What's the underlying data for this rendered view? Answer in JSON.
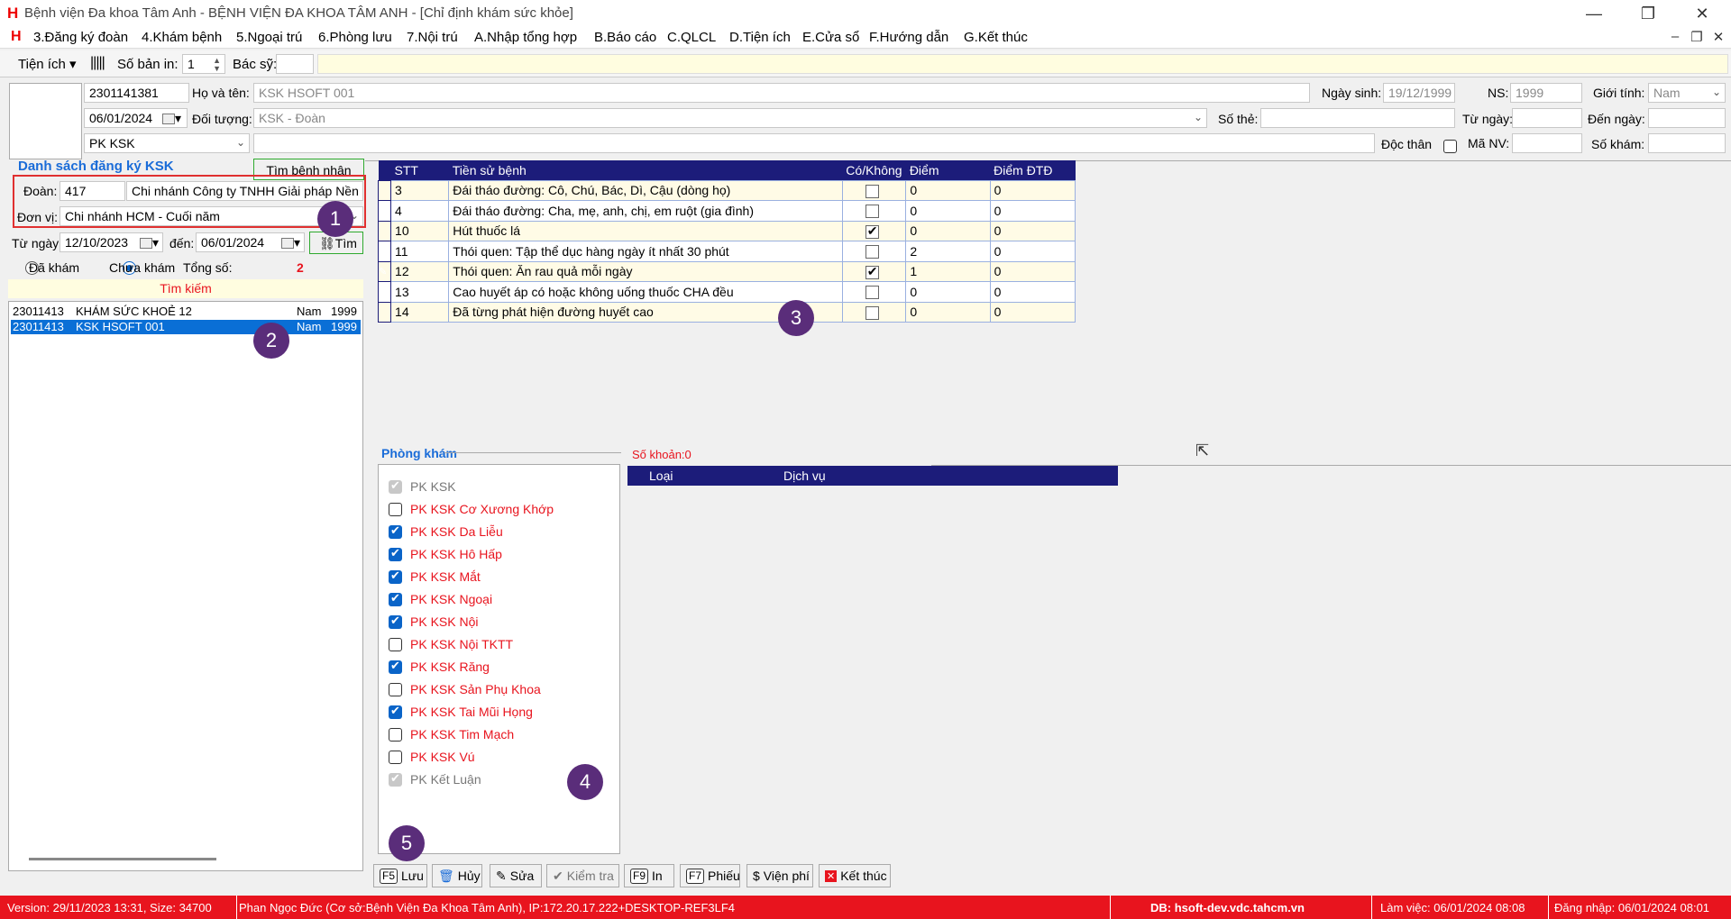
{
  "window": {
    "title": "Bệnh viện Đa khoa Tâm Anh - BỆNH VIỆN ĐA KHOA TÂM ANH - [Chỉ định khám sức khỏe]",
    "logo_glyph": "H"
  },
  "menu": {
    "items": [
      "3.Đăng ký đoàn",
      "4.Khám bệnh",
      "5.Ngoại trú",
      "6.Phòng lưu",
      "7.Nội trú",
      "A.Nhập tổng hợp",
      "B.Báo cáo",
      "C.QLCL",
      "D.Tiện ích",
      "E.Cửa sổ",
      "F.Hướng dẫn",
      "G.Kết thúc"
    ]
  },
  "toolbar": {
    "utilities_label": "Tiện ích",
    "copies_label": "Số bản in:",
    "copies_value": "1",
    "doctor_label": "Bác sỹ:",
    "doctor_value": ""
  },
  "patient": {
    "code": "2301141381",
    "name_label": "Họ và tên:",
    "name": "KSK HSOFT 001",
    "dob_label": "Ngày sinh:",
    "dob": "19/12/1999",
    "ns_label": "NS:",
    "ns": "1999",
    "gender_label": "Giới tính:",
    "gender": "Nam",
    "date": "06/01/2024",
    "object_label": "Đối tượng:",
    "object": "KSK - Đoàn",
    "card_label": "Số thẻ:",
    "from_label": "Từ ngày:",
    "to_label": "Đến ngày:",
    "clinic": "PK KSK",
    "single_label": "Độc thân",
    "staff_label": "Mã NV:",
    "exam_no_label": "Số khám:"
  },
  "registration": {
    "title": "Danh sách đăng ký KSK",
    "find_patient_button": "Tìm bệnh nhân",
    "group_label": "Đoàn:",
    "group_code": "417",
    "group_name": "Chi nhánh Công ty TNHH Giải pháp Nền tảng",
    "unit_label": "Đơn vị:",
    "unit": "Chi nhánh HCM - Cuối năm",
    "from_label": "Từ ngày:",
    "from_date": "12/10/2023",
    "to_label": "đến:",
    "to_date": "06/01/2024",
    "find_button": "Tìm",
    "examined_label": "Đã khám",
    "not_examined_label": "Chưa khám",
    "total_label": "Tổng số:",
    "total_value": "2",
    "search_label": "Tìm kiếm",
    "list": [
      {
        "code": "23011413",
        "name": "KHÁM SỨC KHOẺ 12",
        "gender": "Nam",
        "year": "1999",
        "selected": false
      },
      {
        "code": "23011413",
        "name": "KSK HSOFT 001",
        "gender": "Nam",
        "year": "1999",
        "selected": true
      }
    ]
  },
  "history": {
    "headers": [
      "STT",
      "Tiền sử bệnh",
      "Có/Không",
      "Điểm",
      "Điểm ĐTĐ"
    ],
    "rows": [
      {
        "stt": "3",
        "desc": "Đái tháo đường: Cô, Chú, Bác, Dì, Cậu (dòng họ)",
        "checked": false,
        "score": "0",
        "dtd": "0"
      },
      {
        "stt": "4",
        "desc": "Đái tháo đường: Cha, mẹ, anh, chị, em ruột (gia đình)",
        "checked": false,
        "score": "0",
        "dtd": "0"
      },
      {
        "stt": "10",
        "desc": "Hút thuốc lá",
        "checked": true,
        "score": "0",
        "dtd": "0"
      },
      {
        "stt": "11",
        "desc": "Thói quen: Tập thể dục hàng ngày ít nhất 30 phút",
        "checked": false,
        "score": "2",
        "dtd": "0"
      },
      {
        "stt": "12",
        "desc": "Thói quen: Ăn rau quả mỗi ngày",
        "checked": true,
        "score": "1",
        "dtd": "0"
      },
      {
        "stt": "13",
        "desc": "Cao huyết áp có hoặc không uống thuốc CHA đều",
        "checked": false,
        "score": "0",
        "dtd": "0"
      },
      {
        "stt": "14",
        "desc": "Đã từng phát hiện đường huyết cao",
        "checked": false,
        "score": "0",
        "dtd": "0"
      }
    ]
  },
  "clinics": {
    "title": "Phòng khám",
    "items": [
      {
        "label": "PK KSK",
        "state": "disabled-checked"
      },
      {
        "label": "PK KSK Cơ Xương Khớp",
        "state": "unchecked"
      },
      {
        "label": "PK KSK Da Liễu",
        "state": "checked"
      },
      {
        "label": "PK KSK Hô Hấp",
        "state": "checked"
      },
      {
        "label": "PK KSK Mắt",
        "state": "checked"
      },
      {
        "label": "PK KSK Ngoại",
        "state": "checked"
      },
      {
        "label": "PK KSK Nội",
        "state": "checked"
      },
      {
        "label": "PK KSK Nội TKTT",
        "state": "unchecked"
      },
      {
        "label": "PK KSK Răng",
        "state": "checked"
      },
      {
        "label": "PK KSK Sản Phụ Khoa",
        "state": "unchecked"
      },
      {
        "label": "PK KSK Tai Mũi Họng",
        "state": "checked"
      },
      {
        "label": "PK KSK Tim Mạch",
        "state": "unchecked"
      },
      {
        "label": "PK KSK Vú",
        "state": "unchecked"
      },
      {
        "label": "PK Kết Luận",
        "state": "disabled-checked"
      }
    ]
  },
  "services": {
    "count_label": "Số khoản:0",
    "headers": [
      "Loại",
      "Dịch vụ"
    ]
  },
  "actions": {
    "save_key": "F5",
    "save": "Lưu",
    "cancel": "Hủy",
    "edit": "Sửa",
    "check": "Kiểm tra",
    "print_key": "F9",
    "print": "In",
    "slip_key": "F7",
    "slip": "Phiếu",
    "fee": "Viện phí",
    "exit": "Kết thúc"
  },
  "annotations": [
    "1",
    "2",
    "3",
    "4",
    "5"
  ],
  "status": {
    "version": "Version: 29/11/2023 13:31, Size: 34700",
    "user": "Phan Ngọc Đức (Cơ sở:Bệnh Viện Đa Khoa Tâm Anh), IP:172.20.17.222+DESKTOP-REF3LF4",
    "db": "DB: hsoft-dev.vdc.tahcm.vn",
    "work": "Làm việc: 06/01/2024 08:08",
    "login": "Đăng nhập: 06/01/2024 08:01"
  },
  "colors": {
    "header_navy": "#1c1c7a",
    "status_red": "#e8141e",
    "clinic_red": "#e8141e",
    "accent_blue": "#1a6cd8",
    "annotation_purple": "#5a2d7a"
  }
}
